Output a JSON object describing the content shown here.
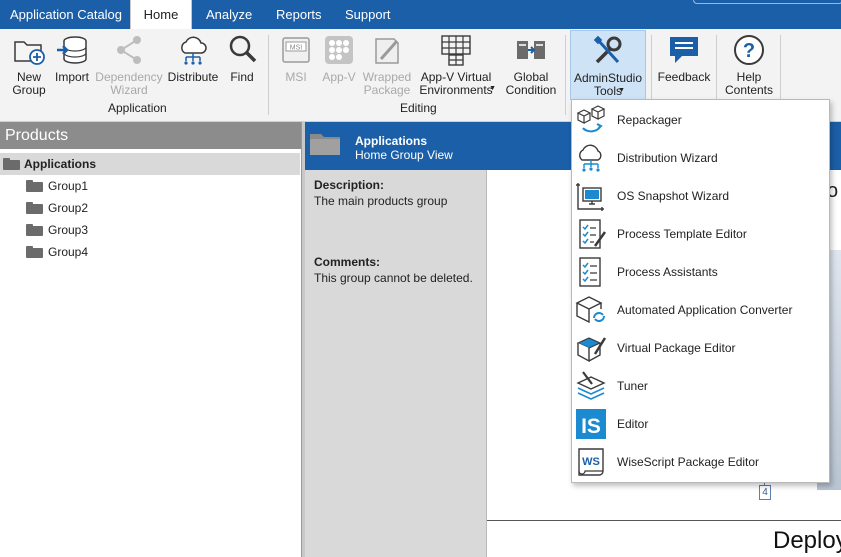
{
  "tabs": {
    "catalog": "Application Catalog",
    "home": "Home",
    "analyze": "Analyze",
    "reports": "Reports",
    "support": "Support"
  },
  "ribbon": {
    "application_group": "Application",
    "editing_group": "Editing",
    "new_group": "New\nGroup",
    "import": "Import",
    "dependency_wizard": "Dependency\nWizard",
    "distribute": "Distribute",
    "find": "Find",
    "msi": "MSI",
    "appv": "App-V",
    "wrapped_package": "Wrapped\nPackage",
    "appv_virtual_environments": "App-V Virtual\nEnvironments",
    "global_condition": "Global\nCondition",
    "adminstudio_tools": "AdminStudio\nTools",
    "feedback": "Feedback",
    "help_contents": "Help\nContents"
  },
  "left": {
    "header": "Products",
    "root": "Applications",
    "groups": [
      "Group1",
      "Group2",
      "Group3",
      "Group4"
    ]
  },
  "right": {
    "title": "Applications",
    "subtitle": "Home Group View",
    "description_label": "Description:",
    "description_value": "The main products group",
    "comments_label": "Comments:",
    "comments_value": "This group cannot be deleted.",
    "canvas_text": "Deploy",
    "canvas_edge_char": "o",
    "badge": "4"
  },
  "menu": {
    "items": [
      {
        "label": "Repackager",
        "icon": "repackager-icon"
      },
      {
        "label": "Distribution Wizard",
        "icon": "cloud-distribution-icon"
      },
      {
        "label": "OS Snapshot Wizard",
        "icon": "monitor-snapshot-icon"
      },
      {
        "label": "Process Template Editor",
        "icon": "checklist-pen-icon"
      },
      {
        "label": "Process Assistants",
        "icon": "checklist-icon"
      },
      {
        "label": "Automated Application Converter",
        "icon": "box-refresh-icon"
      },
      {
        "label": "Virtual Package Editor",
        "icon": "box-pen-icon"
      },
      {
        "label": "Tuner",
        "icon": "layers-wand-icon"
      },
      {
        "label": "Editor",
        "icon": "installshield-icon"
      },
      {
        "label": "WiseScript Package Editor",
        "icon": "wisescript-icon"
      }
    ]
  },
  "colors": {
    "accent": "#1b5fa8",
    "panel_gray": "#d9d9d9",
    "header_gray": "#8c8c8c"
  }
}
